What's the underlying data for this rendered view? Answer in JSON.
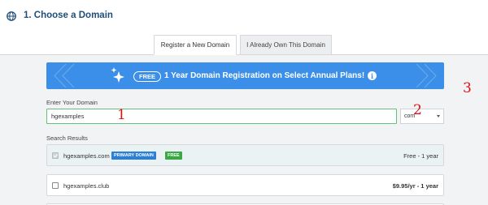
{
  "section": {
    "title": "1. Choose a Domain",
    "icon": "globe-icon"
  },
  "tabs": [
    {
      "label": "Register a New Domain",
      "active": true
    },
    {
      "label": "I Already Own This Domain",
      "active": false
    }
  ],
  "banner": {
    "badge": "FREE",
    "text": "1 Year Domain Registration on Select Annual Plans!",
    "info_glyph": "i",
    "color": "#3b8fe8"
  },
  "markers": [
    "1",
    "2",
    "3"
  ],
  "domain_field": {
    "label": "Enter Your Domain",
    "value": "hgexamples"
  },
  "tld_select": {
    "value": "com"
  },
  "results": {
    "label": "Search Results",
    "rows": [
      {
        "domain": "hgexamples.com",
        "tags": [
          "PRIMARY DOMAIN",
          "FREE"
        ],
        "price": "Free - 1 year",
        "checked": true
      },
      {
        "domain": "hgexamples.club",
        "tags": [],
        "price": "$9.95/yr - 1 year",
        "checked": false
      }
    ]
  },
  "colors": {
    "accent": "#3b8fe8",
    "primary_tag": "#2b7fd6",
    "free_tag": "#3aa845",
    "input_focus": "#62c27d",
    "marker": "#e01010"
  }
}
